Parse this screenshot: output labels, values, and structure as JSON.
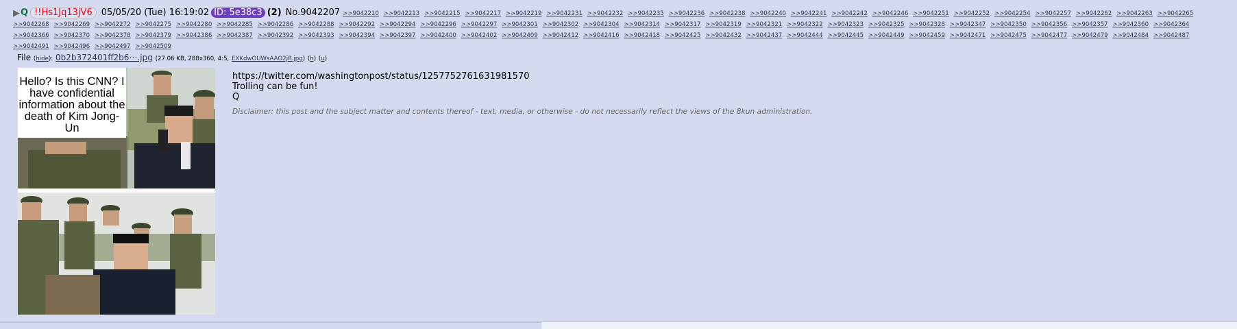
{
  "post": {
    "expand_arrow": "▶",
    "name": "Q",
    "tripcode": "!!Hs1Jq13jV6",
    "datetime": "05/05/20 (Tue) 16:19:02",
    "id_badge": "ID: 5e38c3",
    "id_count": "(2)",
    "post_number": "No.9042207",
    "replies": [
      ">>9042210",
      ">>9042213",
      ">>9042215",
      ">>9042217",
      ">>9042219",
      ">>9042231",
      ">>9042232",
      ">>9042235",
      ">>9042236",
      ">>9042238",
      ">>9042240",
      ">>9042241",
      ">>9042242",
      ">>9042246",
      ">>9042251",
      ">>9042252",
      ">>9042254",
      ">>9042257",
      ">>9042262",
      ">>9042263",
      ">>9042265",
      ">>9042268",
      ">>9042269",
      ">>9042272",
      ">>9042275",
      ">>9042280",
      ">>9042285",
      ">>9042286",
      ">>9042288",
      ">>9042292",
      ">>9042294",
      ">>9042296",
      ">>9042297",
      ">>9042301",
      ">>9042302",
      ">>9042304",
      ">>9042314",
      ">>9042317",
      ">>9042319",
      ">>9042321",
      ">>9042322",
      ">>9042323",
      ">>9042325",
      ">>9042328",
      ">>9042347",
      ">>9042350",
      ">>9042356",
      ">>9042357",
      ">>9042360",
      ">>9042364",
      ">>9042366",
      ">>9042370",
      ">>9042378",
      ">>9042379",
      ">>9042386",
      ">>9042387",
      ">>9042392",
      ">>9042393",
      ">>9042394",
      ">>9042397",
      ">>9042400",
      ">>9042402",
      ">>9042409",
      ">>9042412",
      ">>9042416",
      ">>9042418",
      ">>9042425",
      ">>9042432",
      ">>9042437",
      ">>9042444",
      ">>9042445",
      ">>9042449",
      ">>9042459",
      ">>9042471",
      ">>9042475",
      ">>9042477",
      ">>9042479",
      ">>9042484",
      ">>9042487",
      ">>9042491",
      ">>9042496",
      ">>9042497",
      ">>9042509"
    ]
  },
  "file": {
    "label": "File",
    "hide_link": "hide",
    "filename": "0b2b372401ff2b6⋯.jpg",
    "meta": "(27.06 KB, 288x360, 4:5,",
    "original_name": "EXKdwOUWsAAO2jR.jpg",
    "h_link": "h",
    "u_link": "u",
    "meta_close": ")",
    "image_caption": "Hello? Is this CNN? I have confidential information about the death of Kim Jong-Un"
  },
  "body": {
    "lines": [
      "https://twitter.com/washingtonpost/status/1257752761631981570",
      "Trolling can be fun!",
      "Q"
    ],
    "disclaimer": "Disclaimer: this post and the subject matter and contents thereof - text, media, or otherwise - do not necessarily reflect the views of the 8kun administration."
  }
}
